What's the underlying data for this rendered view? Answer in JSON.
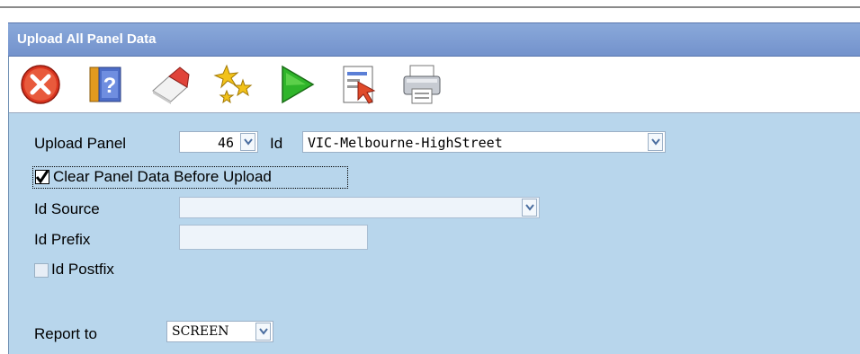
{
  "window": {
    "title": "Upload All Panel Data"
  },
  "toolbar": {
    "items": [
      {
        "icon": "close-icon"
      },
      {
        "icon": "help-book-icon"
      },
      {
        "icon": "eraser-icon"
      },
      {
        "icon": "sparkle-icon"
      },
      {
        "icon": "play-icon"
      },
      {
        "icon": "document-select-icon"
      },
      {
        "icon": "printer-icon"
      }
    ]
  },
  "form": {
    "upload_panel": {
      "label": "Upload Panel",
      "value": "46"
    },
    "id": {
      "label": "Id",
      "value": "VIC-Melbourne-HighStreet"
    },
    "clear_panel": {
      "label": "Clear Panel Data Before Upload",
      "checked": true
    },
    "id_source": {
      "label": "Id Source",
      "value": ""
    },
    "id_prefix": {
      "label": "Id Prefix",
      "value": ""
    },
    "id_postfix": {
      "label": "Id Postfix",
      "checked": false
    },
    "report_to": {
      "label": "Report to",
      "value": "SCREEN"
    }
  }
}
